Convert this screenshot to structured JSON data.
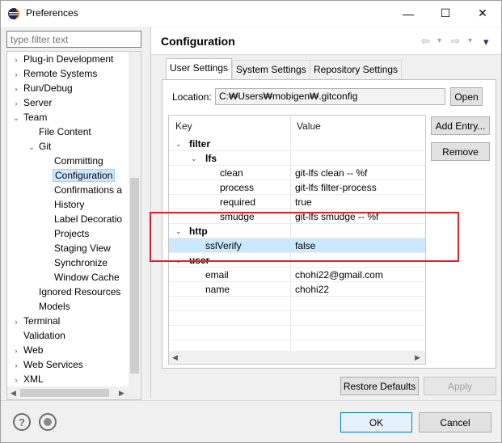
{
  "window": {
    "title": "Preferences",
    "icon": "eclipse-icon",
    "minimize_glyph": "—",
    "maximize_glyph": "☐",
    "close_glyph": "✕"
  },
  "filter": {
    "placeholder": "type filter text"
  },
  "tree": [
    {
      "label": "Plug-in Development",
      "arrow": "›",
      "level": 0
    },
    {
      "label": "Remote Systems",
      "arrow": "›",
      "level": 0
    },
    {
      "label": "Run/Debug",
      "arrow": "›",
      "level": 0
    },
    {
      "label": "Server",
      "arrow": "›",
      "level": 0
    },
    {
      "label": "Team",
      "arrow": "⌄",
      "level": 0
    },
    {
      "label": "File Content",
      "arrow": "",
      "level": 1
    },
    {
      "label": "Git",
      "arrow": "⌄",
      "level": 1
    },
    {
      "label": "Committing",
      "arrow": "",
      "level": 2
    },
    {
      "label": "Configuration",
      "arrow": "",
      "level": 2,
      "selected": true
    },
    {
      "label": "Confirmations a",
      "arrow": "",
      "level": 2
    },
    {
      "label": "History",
      "arrow": "",
      "level": 2
    },
    {
      "label": "Label Decoratio",
      "arrow": "",
      "level": 2
    },
    {
      "label": "Projects",
      "arrow": "",
      "level": 2
    },
    {
      "label": "Staging View",
      "arrow": "",
      "level": 2
    },
    {
      "label": "Synchronize",
      "arrow": "",
      "level": 2
    },
    {
      "label": "Window Cache",
      "arrow": "",
      "level": 2
    },
    {
      "label": "Ignored Resources",
      "arrow": "",
      "level": 1
    },
    {
      "label": "Models",
      "arrow": "",
      "level": 1
    },
    {
      "label": "Terminal",
      "arrow": "›",
      "level": 0
    },
    {
      "label": "Validation",
      "arrow": "",
      "level": 0
    },
    {
      "label": "Web",
      "arrow": "›",
      "level": 0
    },
    {
      "label": "Web Services",
      "arrow": "›",
      "level": 0
    },
    {
      "label": "XML",
      "arrow": "›",
      "level": 0
    }
  ],
  "page": {
    "title": "Configuration",
    "nav": {
      "back": "⇦",
      "forward": "⇨",
      "dropdown": "▾",
      "menu": "▾"
    }
  },
  "tabs": [
    "User Settings",
    "System Settings",
    "Repository Settings"
  ],
  "location": {
    "label": "Location:",
    "value": "C:₩Users₩mobigen₩.gitconfig",
    "open_button": "Open"
  },
  "table": {
    "headers": {
      "key": "Key",
      "value": "Value"
    },
    "rows": [
      {
        "key": "filter",
        "value": "",
        "level": 0,
        "expander": "⌄",
        "bold": true
      },
      {
        "key": "lfs",
        "value": "",
        "level": 1,
        "expander": "⌄",
        "bold": true
      },
      {
        "key": "clean",
        "value": "git-lfs clean -- %f",
        "level": 2
      },
      {
        "key": "process",
        "value": "git-lfs filter-process",
        "level": 2
      },
      {
        "key": "required",
        "value": "true",
        "level": 2
      },
      {
        "key": "smudge",
        "value": "git-lfs smudge -- %f",
        "level": 2
      },
      {
        "key": "http",
        "value": "",
        "level": 0,
        "expander": "⌄",
        "bold": true
      },
      {
        "key": "sslVerify",
        "value": "false",
        "level": 1,
        "selected": true
      },
      {
        "key": "user",
        "value": "",
        "level": 0,
        "expander": "⌄",
        "bold": true
      },
      {
        "key": "email",
        "value": "chohi22@gmail.com",
        "level": 1
      },
      {
        "key": "name",
        "value": "chohi22",
        "level": 1
      }
    ]
  },
  "side_buttons": {
    "add_entry": "Add Entry...",
    "remove": "Remove"
  },
  "page_buttons": {
    "restore_defaults": "Restore Defaults",
    "apply": "Apply"
  },
  "dialog_buttons": {
    "ok": "OK",
    "cancel": "Cancel",
    "help": "?"
  },
  "colors": {
    "highlight": "#e21f26",
    "selection": "#cce8ff"
  }
}
